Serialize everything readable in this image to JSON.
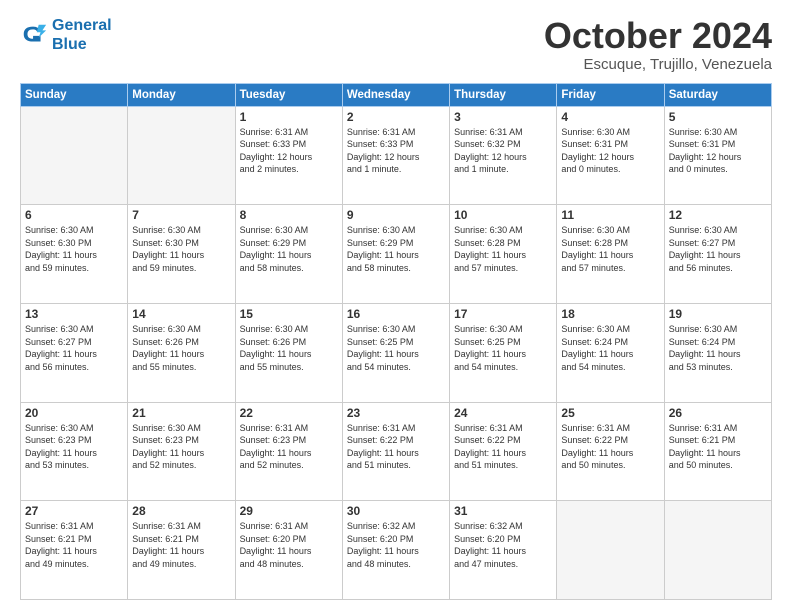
{
  "logo": {
    "line1": "General",
    "line2": "Blue"
  },
  "title": "October 2024",
  "location": "Escuque, Trujillo, Venezuela",
  "days_of_week": [
    "Sunday",
    "Monday",
    "Tuesday",
    "Wednesday",
    "Thursday",
    "Friday",
    "Saturday"
  ],
  "weeks": [
    [
      {
        "day": "",
        "info": ""
      },
      {
        "day": "",
        "info": ""
      },
      {
        "day": "1",
        "info": "Sunrise: 6:31 AM\nSunset: 6:33 PM\nDaylight: 12 hours\nand 2 minutes."
      },
      {
        "day": "2",
        "info": "Sunrise: 6:31 AM\nSunset: 6:33 PM\nDaylight: 12 hours\nand 1 minute."
      },
      {
        "day": "3",
        "info": "Sunrise: 6:31 AM\nSunset: 6:32 PM\nDaylight: 12 hours\nand 1 minute."
      },
      {
        "day": "4",
        "info": "Sunrise: 6:30 AM\nSunset: 6:31 PM\nDaylight: 12 hours\nand 0 minutes."
      },
      {
        "day": "5",
        "info": "Sunrise: 6:30 AM\nSunset: 6:31 PM\nDaylight: 12 hours\nand 0 minutes."
      }
    ],
    [
      {
        "day": "6",
        "info": "Sunrise: 6:30 AM\nSunset: 6:30 PM\nDaylight: 11 hours\nand 59 minutes."
      },
      {
        "day": "7",
        "info": "Sunrise: 6:30 AM\nSunset: 6:30 PM\nDaylight: 11 hours\nand 59 minutes."
      },
      {
        "day": "8",
        "info": "Sunrise: 6:30 AM\nSunset: 6:29 PM\nDaylight: 11 hours\nand 58 minutes."
      },
      {
        "day": "9",
        "info": "Sunrise: 6:30 AM\nSunset: 6:29 PM\nDaylight: 11 hours\nand 58 minutes."
      },
      {
        "day": "10",
        "info": "Sunrise: 6:30 AM\nSunset: 6:28 PM\nDaylight: 11 hours\nand 57 minutes."
      },
      {
        "day": "11",
        "info": "Sunrise: 6:30 AM\nSunset: 6:28 PM\nDaylight: 11 hours\nand 57 minutes."
      },
      {
        "day": "12",
        "info": "Sunrise: 6:30 AM\nSunset: 6:27 PM\nDaylight: 11 hours\nand 56 minutes."
      }
    ],
    [
      {
        "day": "13",
        "info": "Sunrise: 6:30 AM\nSunset: 6:27 PM\nDaylight: 11 hours\nand 56 minutes."
      },
      {
        "day": "14",
        "info": "Sunrise: 6:30 AM\nSunset: 6:26 PM\nDaylight: 11 hours\nand 55 minutes."
      },
      {
        "day": "15",
        "info": "Sunrise: 6:30 AM\nSunset: 6:26 PM\nDaylight: 11 hours\nand 55 minutes."
      },
      {
        "day": "16",
        "info": "Sunrise: 6:30 AM\nSunset: 6:25 PM\nDaylight: 11 hours\nand 54 minutes."
      },
      {
        "day": "17",
        "info": "Sunrise: 6:30 AM\nSunset: 6:25 PM\nDaylight: 11 hours\nand 54 minutes."
      },
      {
        "day": "18",
        "info": "Sunrise: 6:30 AM\nSunset: 6:24 PM\nDaylight: 11 hours\nand 54 minutes."
      },
      {
        "day": "19",
        "info": "Sunrise: 6:30 AM\nSunset: 6:24 PM\nDaylight: 11 hours\nand 53 minutes."
      }
    ],
    [
      {
        "day": "20",
        "info": "Sunrise: 6:30 AM\nSunset: 6:23 PM\nDaylight: 11 hours\nand 53 minutes."
      },
      {
        "day": "21",
        "info": "Sunrise: 6:30 AM\nSunset: 6:23 PM\nDaylight: 11 hours\nand 52 minutes."
      },
      {
        "day": "22",
        "info": "Sunrise: 6:31 AM\nSunset: 6:23 PM\nDaylight: 11 hours\nand 52 minutes."
      },
      {
        "day": "23",
        "info": "Sunrise: 6:31 AM\nSunset: 6:22 PM\nDaylight: 11 hours\nand 51 minutes."
      },
      {
        "day": "24",
        "info": "Sunrise: 6:31 AM\nSunset: 6:22 PM\nDaylight: 11 hours\nand 51 minutes."
      },
      {
        "day": "25",
        "info": "Sunrise: 6:31 AM\nSunset: 6:22 PM\nDaylight: 11 hours\nand 50 minutes."
      },
      {
        "day": "26",
        "info": "Sunrise: 6:31 AM\nSunset: 6:21 PM\nDaylight: 11 hours\nand 50 minutes."
      }
    ],
    [
      {
        "day": "27",
        "info": "Sunrise: 6:31 AM\nSunset: 6:21 PM\nDaylight: 11 hours\nand 49 minutes."
      },
      {
        "day": "28",
        "info": "Sunrise: 6:31 AM\nSunset: 6:21 PM\nDaylight: 11 hours\nand 49 minutes."
      },
      {
        "day": "29",
        "info": "Sunrise: 6:31 AM\nSunset: 6:20 PM\nDaylight: 11 hours\nand 48 minutes."
      },
      {
        "day": "30",
        "info": "Sunrise: 6:32 AM\nSunset: 6:20 PM\nDaylight: 11 hours\nand 48 minutes."
      },
      {
        "day": "31",
        "info": "Sunrise: 6:32 AM\nSunset: 6:20 PM\nDaylight: 11 hours\nand 47 minutes."
      },
      {
        "day": "",
        "info": ""
      },
      {
        "day": "",
        "info": ""
      }
    ]
  ]
}
